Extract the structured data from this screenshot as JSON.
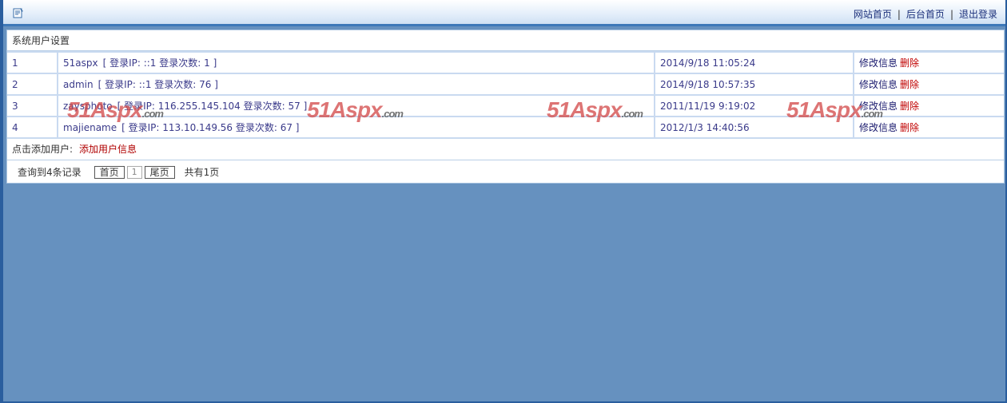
{
  "header": {
    "nav": [
      {
        "label": "网站首页"
      },
      {
        "label": "后台首页"
      },
      {
        "label": "退出登录"
      }
    ],
    "separator": "|"
  },
  "panel": {
    "title": "系统用户设置",
    "users": [
      {
        "id": "1",
        "name": "51aspx",
        "meta": "[ 登录IP: ::1  登录次数: 1 ]",
        "time": "2014/9/18 11:05:24",
        "edit": "修改信息",
        "delete": "删除"
      },
      {
        "id": "2",
        "name": "admin",
        "meta": "[ 登录IP: ::1  登录次数: 76 ]",
        "time": "2014/9/18 10:57:35",
        "edit": "修改信息",
        "delete": "删除"
      },
      {
        "id": "3",
        "name": "zaysphoto",
        "meta": "[ 登录IP: 116.255.145.104  登录次数: 57 ]",
        "time": "2011/11/19 9:19:02",
        "edit": "修改信息",
        "delete": "删除"
      },
      {
        "id": "4",
        "name": "majiename",
        "meta": "[ 登录IP: 113.10.149.56  登录次数: 67 ]",
        "time": "2012/1/3 14:40:56",
        "edit": "修改信息",
        "delete": "删除"
      }
    ],
    "add_prefix": "点击添加用户:",
    "add_link": "添加用户信息",
    "pager": {
      "count_text": "查询到4条记录",
      "first": "首页",
      "page": "1",
      "last": "尾页",
      "total_text": "共有1页"
    }
  },
  "watermark": {
    "text": "51Aspx",
    "suffix": ".com"
  },
  "colors": {
    "background": "#6691bf",
    "accent": "#2a5e9e",
    "delete": "#c00000"
  }
}
